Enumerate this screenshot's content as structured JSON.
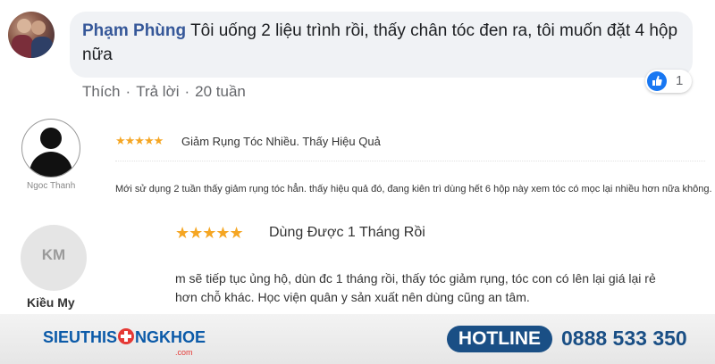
{
  "fb_comment": {
    "author": "Phạm Phùng",
    "text": "Tôi uống 2 liệu trình rồi, thấy chân tóc đen ra, tôi muốn đặt 4 hộp nữa",
    "actions": {
      "like": "Thích",
      "reply": "Trả lời",
      "time": "20 tuần"
    },
    "like_count": "1"
  },
  "reviews": [
    {
      "name": "Ngoc Thanh",
      "stars": "★★★★★",
      "title": "Giảm Rụng Tóc Nhiều. Thấy Hiệu Quả",
      "body": "Mới sử dụng 2 tuần thấy giảm rụng tóc hẳn. thấy hiệu quả đó, đang kiên trì dùng hết 6 hộp này xem tóc có mọc lại nhiều hơn nữa không."
    },
    {
      "name": "Kiều My",
      "initials": "KM",
      "stars": "★★★★★",
      "title": "Dùng Được 1 Tháng Rồi",
      "body": "m sẽ tiếp tục ủng hộ, dùn đc 1 tháng rồi, thấy tóc giảm rụng, tóc con có lên lại giá lại rẻ hơn chỗ khác. Học viện quân y sản xuất nên dùng cũng an tâm."
    }
  ],
  "footer": {
    "logo_left": "SIEUTHIS",
    "logo_right": "NGKHOE",
    "logo_sub": ".com",
    "hotline_label": "HOTLINE",
    "phone": "0888 533 350"
  },
  "colors": {
    "brand_blue": "#1a4f85",
    "brand_red": "#e53935",
    "star": "#f5a623",
    "fb_name": "#365899"
  }
}
